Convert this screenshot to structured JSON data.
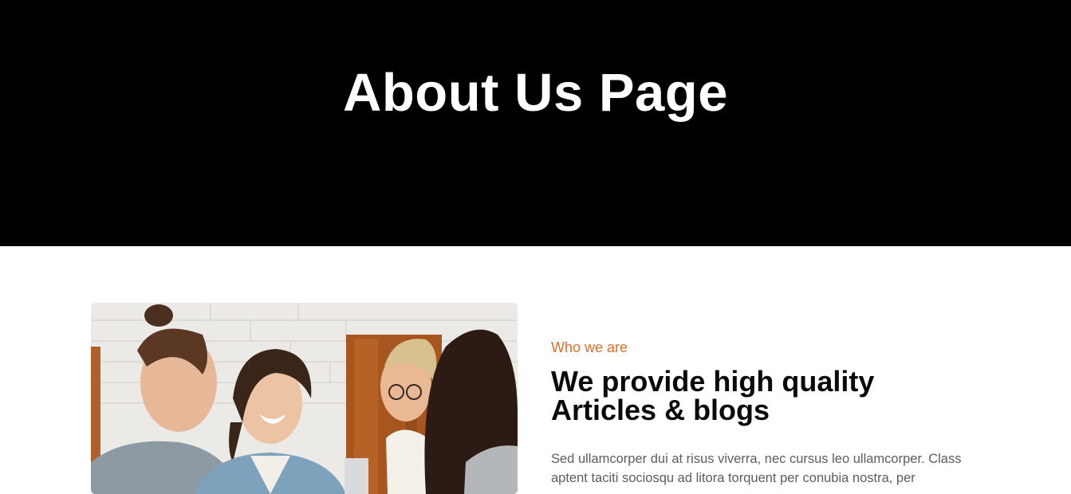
{
  "hero": {
    "title": "About Us Page",
    "background": "#000000"
  },
  "about": {
    "image_alt": "Group of young people smiling and chatting around a laptop",
    "eyebrow": "Who we are",
    "eyebrow_color": "#e06f2c",
    "heading_line1": "We provide high quality",
    "heading_line2": "Articles & blogs",
    "body": "Sed ullamcorper dui at risus viverra, nec cursus leo ullamcorper. Class aptent taciti sociosqu ad litora torquent per conubia nostra, per"
  }
}
